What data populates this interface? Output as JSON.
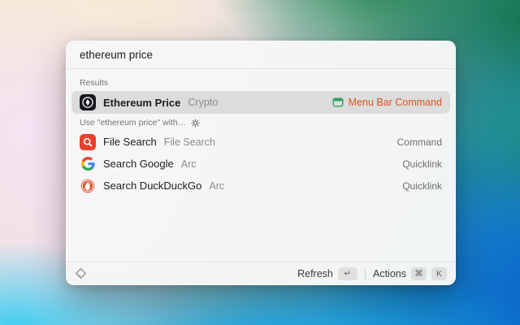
{
  "colors": {
    "accent_orange": "#D9541F",
    "accent_green": "#2F9E63",
    "selection_bg": "#DCDCDD",
    "file_search_red": "#E8402D",
    "duckduckgo_red": "#DE5833",
    "ethereum_icon_bg": "#16181D"
  },
  "search": {
    "value": "ethereum price"
  },
  "sections": {
    "results": {
      "label": "Results",
      "row": {
        "icon": "ethereum-icon",
        "title": "Ethereum Price",
        "subtitle": "Crypto",
        "accessory_icon": "menu-bar-icon",
        "accessory": "Menu Bar Command"
      }
    },
    "use_with": {
      "label": "Use \"ethereum price\" with…",
      "gear_icon": "gear-icon",
      "rows": [
        {
          "icon": "file-search-icon",
          "title": "File Search",
          "subtitle": "File Search",
          "accessory": "Command"
        },
        {
          "icon": "google-icon",
          "title": "Search Google",
          "subtitle": "Arc",
          "accessory": "Quicklink"
        },
        {
          "icon": "duckduckgo-icon",
          "title": "Search DuckDuckGo",
          "subtitle": "Arc",
          "accessory": "Quicklink"
        }
      ]
    }
  },
  "footer": {
    "extension_icon": "diamond-extension-icon",
    "refresh_label": "Refresh",
    "refresh_key": "↵",
    "separator": "|",
    "actions_label": "Actions",
    "cmd_key": "⌘",
    "k_key": "K"
  }
}
